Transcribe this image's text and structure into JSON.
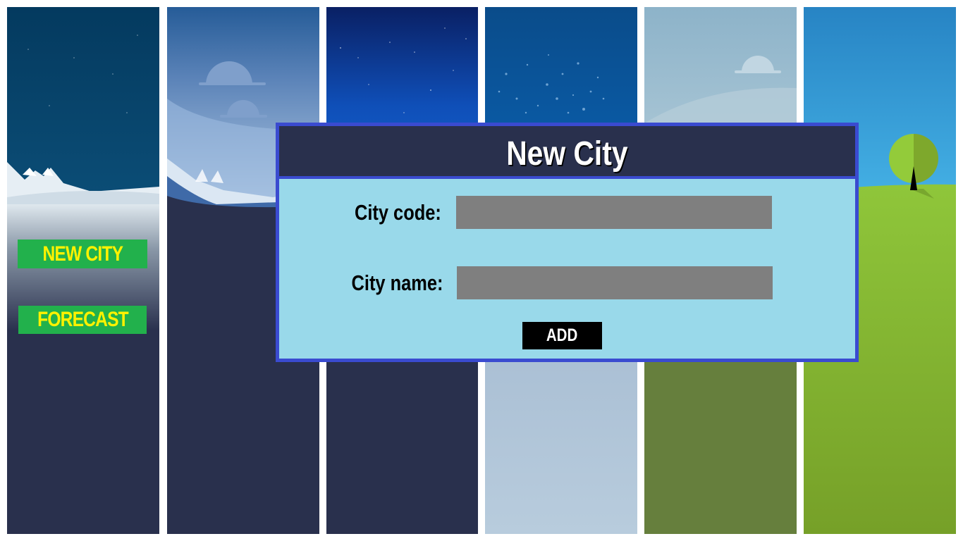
{
  "sidebar": {
    "new_city_label": "NEW CITY",
    "forecast_label": "FORECAST"
  },
  "dialog": {
    "title": "New City",
    "city_code_label": "City code:",
    "city_code_value": "",
    "city_name_label": "City name:",
    "city_name_value": "",
    "add_label": "ADD"
  },
  "backgrounds": [
    {
      "name": "snowy-night-mountains",
      "sky": "#043a60",
      "ground": "#29304d"
    },
    {
      "name": "cloudy-day-mountains",
      "sky": "#2b5d98",
      "ground": "#29304d"
    },
    {
      "name": "starry-night",
      "sky": "#0d47a1",
      "ground": "#29304d"
    },
    {
      "name": "snowfall",
      "sky": "#0a5ca3",
      "ground": "#a6bcd4"
    },
    {
      "name": "foggy-hills",
      "sky": "#9ebfd2",
      "ground": "#667f3d"
    },
    {
      "name": "sunny-meadow-tree",
      "sky": "#2b8fcf",
      "ground": "#8cc63f"
    }
  ],
  "colors": {
    "button_bg": "#22b14c",
    "button_text": "#fff200",
    "dialog_border": "#3a4bd0",
    "dialog_header": "#29304d",
    "dialog_body": "#99d9ea",
    "input_bg": "#7f7f7f",
    "add_bg": "#000000"
  }
}
